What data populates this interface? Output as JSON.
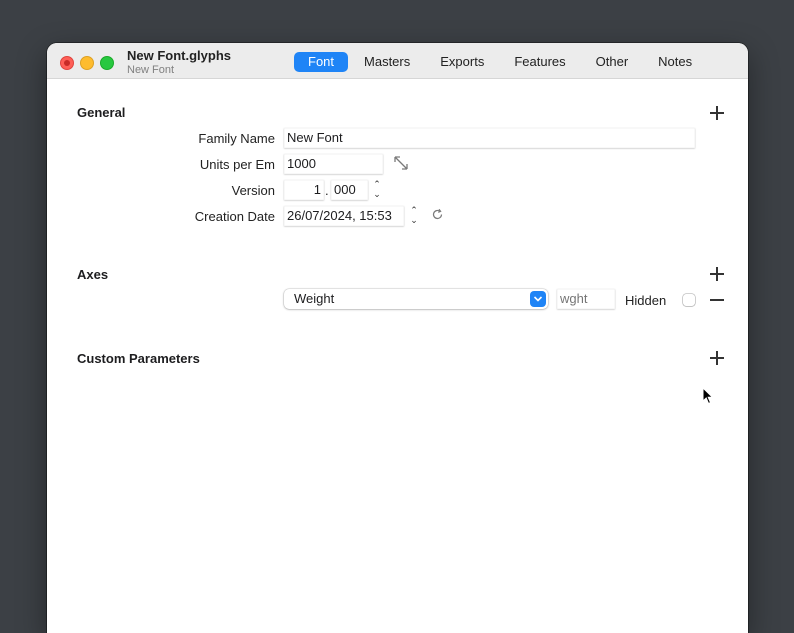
{
  "window": {
    "title": "New Font.glyphs",
    "subtitle": "New Font"
  },
  "tabs": [
    {
      "label": "Font",
      "active": true
    },
    {
      "label": "Masters",
      "active": false
    },
    {
      "label": "Exports",
      "active": false
    },
    {
      "label": "Features",
      "active": false
    },
    {
      "label": "Other",
      "active": false
    },
    {
      "label": "Notes",
      "active": false
    }
  ],
  "general": {
    "title": "General",
    "family_name_label": "Family Name",
    "family_name_value": "New Font",
    "units_label": "Units per Em",
    "units_value": "1000",
    "version_label": "Version",
    "version_major": "1",
    "version_separator": ".",
    "version_minor": "000",
    "creation_date_label": "Creation Date",
    "creation_date_value": "26/07/2024, 15:53"
  },
  "axes": {
    "title": "Axes",
    "axis_name": "Weight",
    "axis_tag_placeholder": "wght",
    "hidden_label": "Hidden"
  },
  "custom_parameters": {
    "title": "Custom Parameters"
  },
  "colors": {
    "accent": "#1f84f6",
    "desktop": "#3c4045"
  },
  "icons": {
    "resize": "arrow-expand-icon",
    "refresh": "refresh-icon",
    "stepper": "stepper-icon",
    "cursor": "mouse-pointer-icon"
  }
}
